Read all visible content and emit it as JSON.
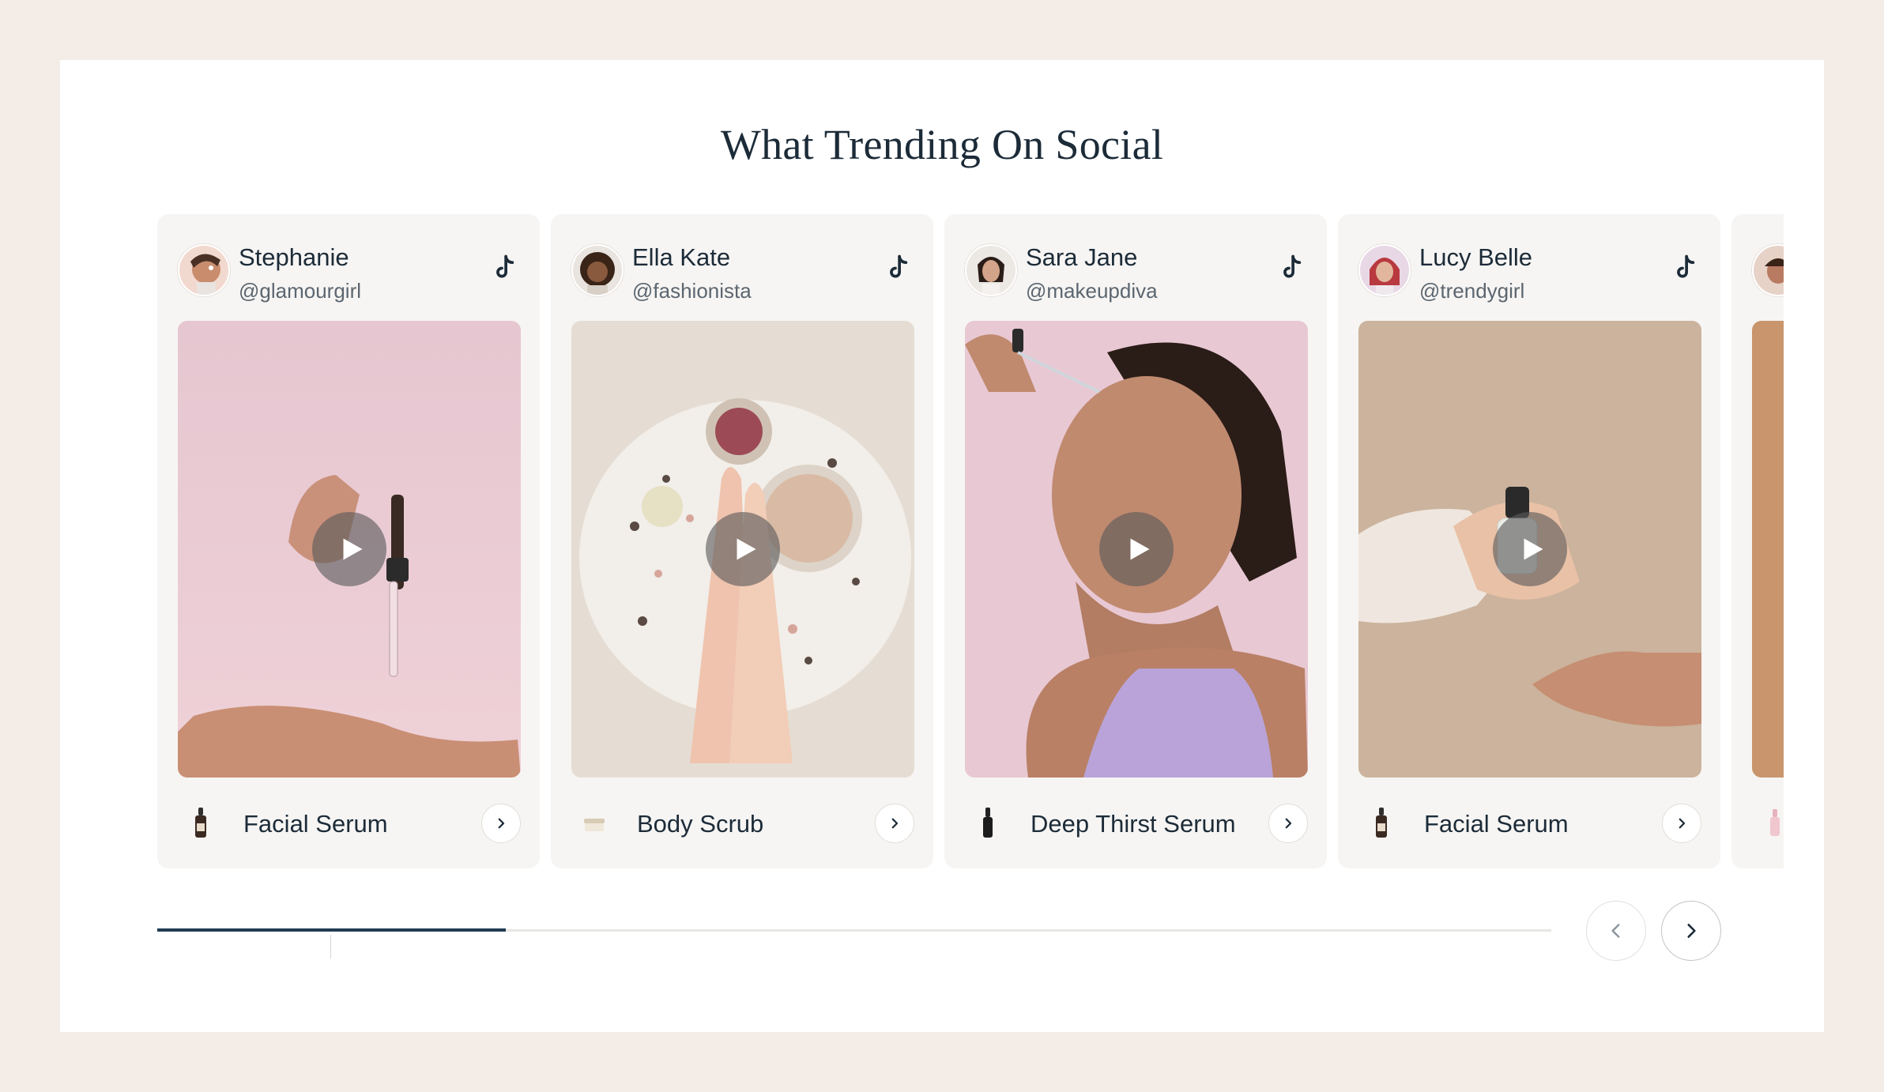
{
  "section": {
    "title": "What Trending On Social"
  },
  "cards": [
    {
      "name": "Stephanie",
      "handle": "@glamourgirl",
      "platform_icon": "tiktok-icon",
      "product": "Facial Serum",
      "product_icon": "dropper-bottle-icon"
    },
    {
      "name": "Ella Kate",
      "handle": "@fashionista",
      "platform_icon": "tiktok-icon",
      "product": "Body Scrub",
      "product_icon": "jar-icon"
    },
    {
      "name": "Sara Jane",
      "handle": "@makeupdiva",
      "platform_icon": "tiktok-icon",
      "product": "Deep Thirst Serum",
      "product_icon": "dropper-bottle-icon"
    },
    {
      "name": "Lucy Belle",
      "handle": "@trendygirl",
      "platform_icon": "tiktok-icon",
      "product": "Facial Serum",
      "product_icon": "dropper-bottle-icon"
    }
  ],
  "carousel": {
    "progress": 0.25,
    "prev_icon": "chevron-left-icon",
    "next_icon": "chevron-right-icon"
  },
  "colors": {
    "page_bg": "#f4ece7",
    "card_bg": "#f6f5f3",
    "accent": "#1f3b52",
    "text": "#1c2b38"
  }
}
